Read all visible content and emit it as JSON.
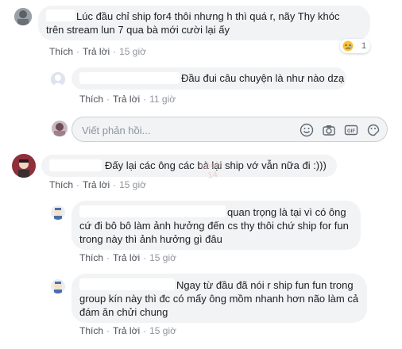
{
  "comments": [
    {
      "text_line1": "Lúc đầu chỉ ship for4 thôi nhưng h thì quá r, nãy Thy khóc",
      "text_line2": "trên stream lun 7 qua bà mới cười lại ấy",
      "like_label": "Thích",
      "reply_label": "Trả lời",
      "time": "15 giờ",
      "reaction_count": "1",
      "reaction_icon": "sad-reaction-icon"
    },
    {
      "text": "Đầu đui câu chuyện là như nào dzạ",
      "like_label": "Thích",
      "reply_label": "Trả lời",
      "time": "11 giờ"
    },
    {
      "text": "Đấy lại các ông các bà lại ship vớ vẫn nữa đi :)))",
      "like_label": "Thích",
      "reply_label": "Trả lời",
      "time": "15 giờ"
    },
    {
      "text_line1": "quan trọng là tại vì có ông",
      "text_line2": "cứ đi bô bô làm ảnh hưởng đến cs thy thôi chứ ship for fun",
      "text_line3": "trong này thì ảnh hưởng gì đâu",
      "like_label": "Thích",
      "reply_label": "Trả lời",
      "time": "15 giờ"
    },
    {
      "text_line1": "Ngay từ đầu đã nói r ship fun fun trong",
      "text_line2": "group kín này thì đc có mấy ông mồm nhanh hơn não làm cả",
      "text_line3": "đám ăn chửi chung",
      "like_label": "Thích",
      "reply_label": "Trả lời",
      "time": "15 giờ"
    }
  ],
  "reply_input": {
    "placeholder": "Viết phản hồi..."
  },
  "colors": {
    "bubble": "#f2f3f5",
    "meta_text": "#606770",
    "border": "#ccd0d5"
  }
}
